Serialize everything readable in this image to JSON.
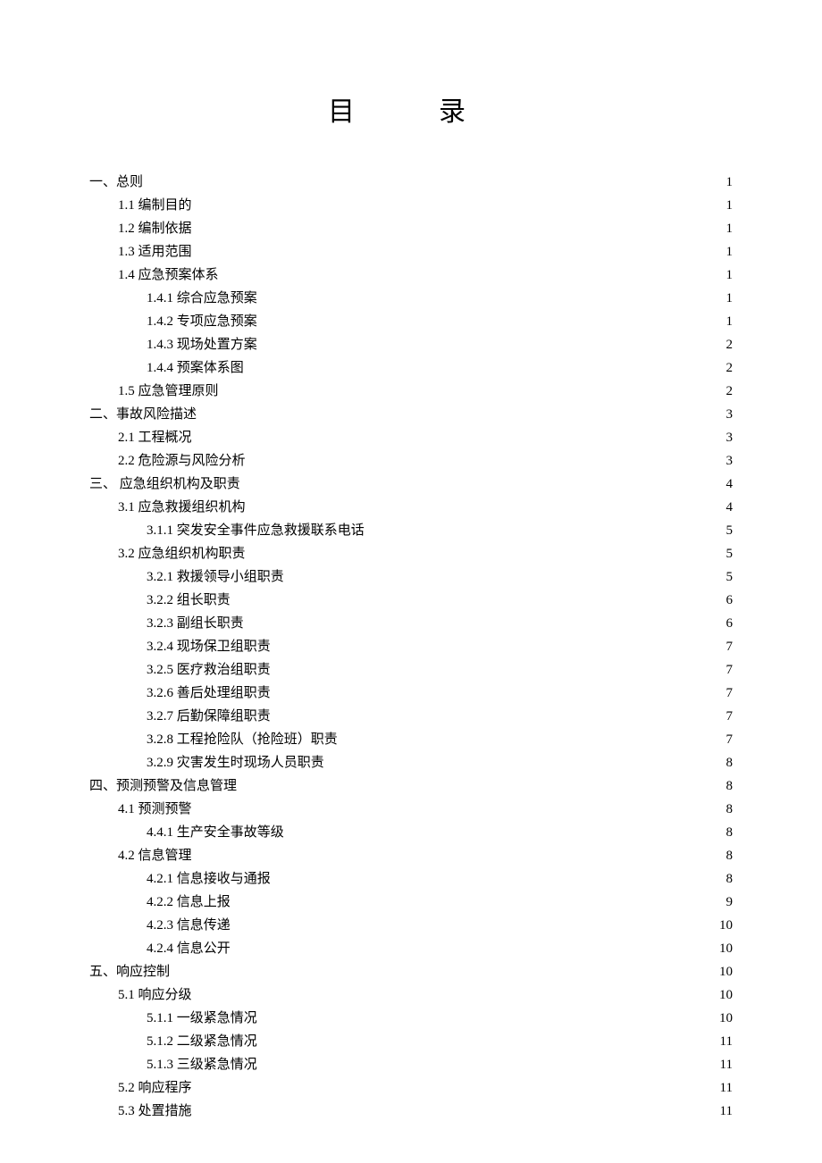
{
  "title": "目　录",
  "toc": [
    {
      "label": "一、总则",
      "page": "1",
      "level": 0
    },
    {
      "label": "1.1 编制目的",
      "page": "1",
      "level": 1
    },
    {
      "label": "1.2 编制依据",
      "page": "1",
      "level": 1
    },
    {
      "label": "1.3 适用范围",
      "page": "1",
      "level": 1
    },
    {
      "label": "1.4 应急预案体系",
      "page": "1",
      "level": 1
    },
    {
      "label": "1.4.1 综合应急预案",
      "page": "1",
      "level": 2
    },
    {
      "label": "1.4.2 专项应急预案",
      "page": "1",
      "level": 2
    },
    {
      "label": "1.4.3 现场处置方案",
      "page": "2",
      "level": 2
    },
    {
      "label": "1.4.4 预案体系图",
      "page": "2",
      "level": 2
    },
    {
      "label": "1.5 应急管理原则",
      "page": "2",
      "level": 1
    },
    {
      "label": "二、事故风险描述",
      "page": "3",
      "level": 0
    },
    {
      "label": "2.1 工程概况",
      "page": "3",
      "level": 1
    },
    {
      "label": "2.2 危险源与风险分析",
      "page": "3",
      "level": 1
    },
    {
      "label": "三、 应急组织机构及职责",
      "page": "4",
      "level": 0
    },
    {
      "label": "3.1 应急救援组织机构",
      "page": "4",
      "level": 1
    },
    {
      "label": "3.1.1 突发安全事件应急救援联系电话",
      "page": "5",
      "level": 2
    },
    {
      "label": "3.2 应急组织机构职责",
      "page": "5",
      "level": 1
    },
    {
      "label": "3.2.1 救援领导小组职责",
      "page": "5",
      "level": 2
    },
    {
      "label": "3.2.2 组长职责",
      "page": "6",
      "level": 2
    },
    {
      "label": "3.2.3 副组长职责",
      "page": "6",
      "level": 2
    },
    {
      "label": "3.2.4 现场保卫组职责",
      "page": "7",
      "level": 2
    },
    {
      "label": "3.2.5 医疗救治组职责",
      "page": "7",
      "level": 2
    },
    {
      "label": "3.2.6 善后处理组职责",
      "page": "7",
      "level": 2
    },
    {
      "label": "3.2.7 后勤保障组职责",
      "page": "7",
      "level": 2
    },
    {
      "label": "3.2.8 工程抢险队（抢险班）职责",
      "page": "7",
      "level": 2
    },
    {
      "label": "3.2.9 灾害发生时现场人员职责",
      "page": "8",
      "level": 2
    },
    {
      "label": "四、预测预警及信息管理",
      "page": "8",
      "level": 0
    },
    {
      "label": "4.1 预测预警",
      "page": "8",
      "level": 1
    },
    {
      "label": "4.4.1 生产安全事故等级",
      "page": "8",
      "level": 2
    },
    {
      "label": "4.2 信息管理",
      "page": "8",
      "level": 1
    },
    {
      "label": "4.2.1 信息接收与通报",
      "page": "8",
      "level": 2
    },
    {
      "label": "4.2.2 信息上报",
      "page": "9",
      "level": 2
    },
    {
      "label": "4.2.3 信息传递",
      "page": "10",
      "level": 2
    },
    {
      "label": "4.2.4 信息公开",
      "page": "10",
      "level": 2
    },
    {
      "label": "五、响应控制",
      "page": "10",
      "level": 0
    },
    {
      "label": "5.1 响应分级",
      "page": "10",
      "level": 1
    },
    {
      "label": "5.1.1 一级紧急情况",
      "page": "10",
      "level": 2
    },
    {
      "label": "5.1.2 二级紧急情况",
      "page": "11",
      "level": 2
    },
    {
      "label": "5.1.3 三级紧急情况",
      "page": "11",
      "level": 2
    },
    {
      "label": "5.2 响应程序",
      "page": "11",
      "level": 1
    },
    {
      "label": "5.3 处置措施",
      "page": "11",
      "level": 1
    }
  ]
}
